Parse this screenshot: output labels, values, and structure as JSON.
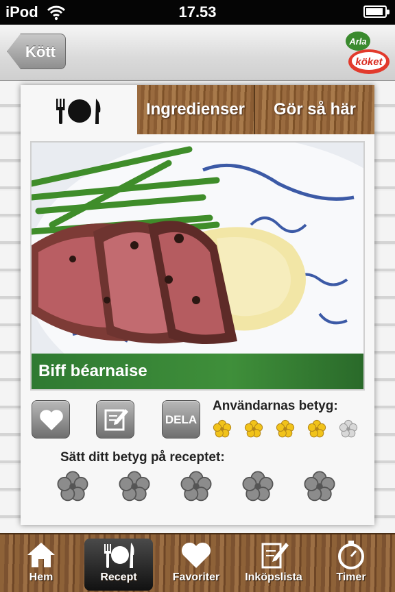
{
  "status_bar": {
    "carrier": "iPod",
    "time": "17.53"
  },
  "nav": {
    "back_label": "Kött",
    "logo_top_text": "Arla",
    "logo_bottom_text": "köket"
  },
  "tabs": {
    "ingredients": "Ingredienser",
    "howto": "Gör så här"
  },
  "recipe": {
    "title": "Biff béarnaise"
  },
  "actions": {
    "share_label": "DELA"
  },
  "ratings": {
    "users_label": "Användarnas betyg:",
    "users_score": 4,
    "users_max": 5,
    "your_label": "Sätt ditt betyg på receptet:",
    "your_max": 5
  },
  "tabbar": [
    {
      "label": "Hem",
      "icon": "home-icon"
    },
    {
      "label": "Recept",
      "icon": "plate-cutlery-icon"
    },
    {
      "label": "Favoriter",
      "icon": "heart-icon"
    },
    {
      "label": "Inköpslista",
      "icon": "shopping-list-icon"
    },
    {
      "label": "Timer",
      "icon": "timer-icon"
    }
  ],
  "colors": {
    "accent_green": "#3f8f3a",
    "star_yellow": "#f1c31a",
    "wood": "#8e6238"
  }
}
